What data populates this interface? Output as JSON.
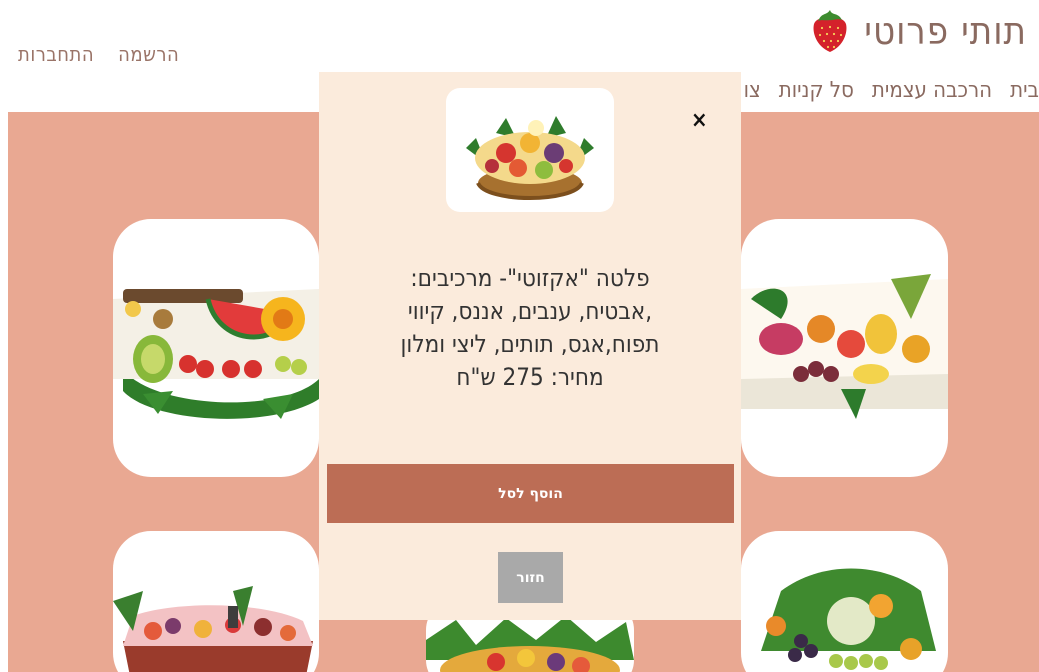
{
  "header": {
    "logo_word1": "תותי",
    "logo_word2": "פרוטי",
    "logo_icon": "strawberry-icon",
    "auth": {
      "register": "הרשמה",
      "login": "התחברות"
    },
    "nav": [
      "בית",
      "הרכבה עצמית",
      "סל קניות",
      "צו"
    ]
  },
  "modal": {
    "thumb_icon": "fruit-basket-image",
    "close_label": "×",
    "description_lines": [
      "פלטה \"אקזוטי\"- מרכיבים:",
      ",אבטיח, ענבים, אננס, קיווי",
      "תפוח,אגס, תותים, ליצי ומלון",
      "מחיר: 275 ש\"ח"
    ],
    "add_to_cart_label": "הוסף לסל",
    "back_label": "חזור"
  },
  "colors": {
    "brand_text": "#8a6a60",
    "background_panel": "#e9a892",
    "modal_bg": "#fbebdc",
    "add_button": "#bc6d55",
    "back_button": "#a9a9a9"
  },
  "products": [
    {
      "image": "fruit-platter-watermelon-image"
    },
    {
      "image": "fruit-platter-exotic-image"
    },
    {
      "image": "fruit-basket-dark-image"
    },
    {
      "image": "fruit-basket-grapes-image"
    },
    {
      "image": "fruit-platter-round-image"
    }
  ]
}
